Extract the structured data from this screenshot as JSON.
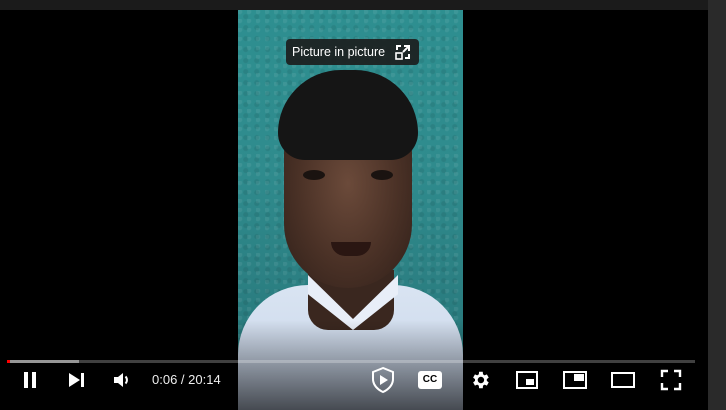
{
  "player": {
    "tooltip": {
      "label": "Picture in picture",
      "icon": "picture-in-picture-icon"
    },
    "progress": {
      "played_fraction": 0.005,
      "buffered_fraction": 0.105
    },
    "time": {
      "current": "0:06",
      "separator": " / ",
      "duration": "20:14"
    },
    "controls": [
      {
        "name": "play-pause-button",
        "icon": "pause-icon"
      },
      {
        "name": "next-button",
        "icon": "next-icon"
      },
      {
        "name": "volume-button",
        "icon": "volume-icon"
      },
      {
        "name": "addon-button",
        "icon": "shield-play-icon"
      },
      {
        "name": "captions-button",
        "icon": "cc-icon",
        "label": "CC"
      },
      {
        "name": "settings-button",
        "icon": "gear-icon"
      },
      {
        "name": "miniplayer-button",
        "icon": "miniplayer-icon"
      },
      {
        "name": "pip-button",
        "icon": "picture-in-picture-icon"
      },
      {
        "name": "theater-button",
        "icon": "theater-mode-icon"
      },
      {
        "name": "fullscreen-button",
        "icon": "fullscreen-icon"
      }
    ],
    "colors": {
      "played": "#ff0000",
      "control": "#ffffff",
      "wall": "#2e8f90"
    }
  }
}
